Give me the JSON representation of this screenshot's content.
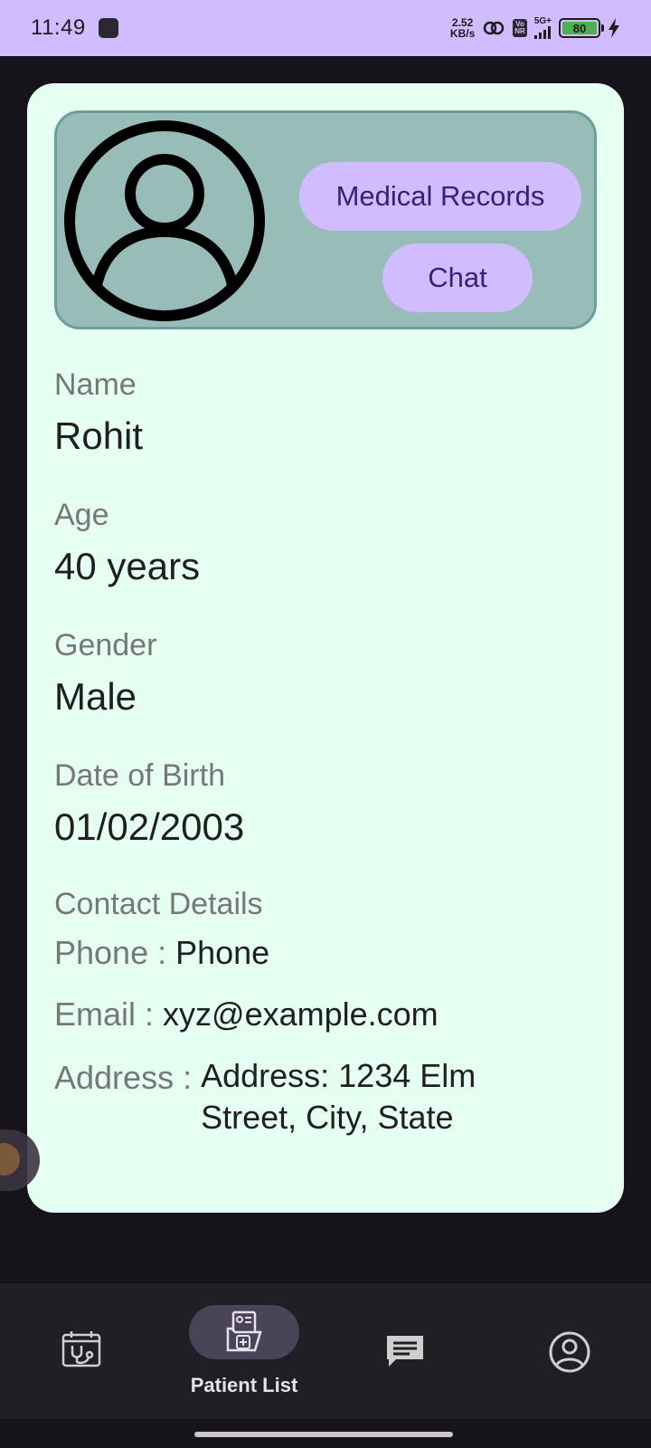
{
  "status_bar": {
    "time": "11:49",
    "net_speed_value": "2.52",
    "net_speed_unit": "KB/s",
    "volte_top": "Vo",
    "volte_bottom": "NR",
    "network_type": "5G+",
    "battery_level": "80",
    "icons": [
      "app-notification-icon",
      "hotspot-icon",
      "signal-icon",
      "battery-icon",
      "charging-bolt-icon"
    ]
  },
  "header": {
    "avatar_icon": "person-circle-icon",
    "medical_records_label": "Medical Records",
    "chat_label": "Chat"
  },
  "patient": {
    "name_label": "Name",
    "name_value": "Rohit",
    "age_label": "Age",
    "age_value": "40 years",
    "gender_label": "Gender",
    "gender_value": "Male",
    "dob_label": "Date of Birth",
    "dob_value": "01/02/2003"
  },
  "contact": {
    "title": "Contact Details",
    "phone_label": "Phone : ",
    "phone_value": "Phone",
    "email_label": "Email : ",
    "email_value": "xyz@example.com",
    "address_label": "Address : ",
    "address_value": "Address: 1234 Elm Street, City, State"
  },
  "bottom_nav": {
    "items": [
      {
        "icon": "calendar-stethoscope-icon",
        "label": ""
      },
      {
        "icon": "patient-list-icon",
        "label": "Patient List",
        "active": true
      },
      {
        "icon": "chat-bubble-icon",
        "label": ""
      },
      {
        "icon": "profile-icon",
        "label": ""
      }
    ]
  },
  "colors": {
    "status_bar": "#d0bcff",
    "background": "#16131a",
    "card": "#e6fff3",
    "header_panel": "#98bcb8",
    "pill_button": "#d0bcff",
    "nav_background": "#211e26",
    "nav_indicator": "#4a4458"
  }
}
